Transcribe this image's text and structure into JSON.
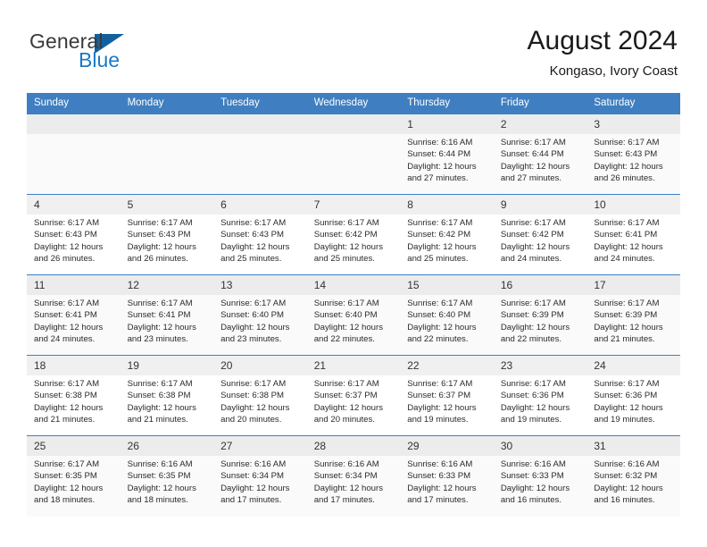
{
  "logo": {
    "word_one": "General",
    "word_two": "Blue",
    "triangle_icon": "blue-triangle-icon",
    "accent_color": "#1a79c8"
  },
  "header": {
    "title": "August 2024",
    "subtitle": "Kongaso, Ivory Coast"
  },
  "colors": {
    "header_blue": "#3f7fc1",
    "daynum_band": "#f0f0f0",
    "row_shaded": "#fafafa",
    "text": "#2b2b2b"
  },
  "weekday_headers": [
    "Sunday",
    "Monday",
    "Tuesday",
    "Wednesday",
    "Thursday",
    "Friday",
    "Saturday"
  ],
  "weeks": [
    [
      {
        "day": "",
        "sunrise": "",
        "sunset": "",
        "daylight_line1": "",
        "daylight_line2": ""
      },
      {
        "day": "",
        "sunrise": "",
        "sunset": "",
        "daylight_line1": "",
        "daylight_line2": ""
      },
      {
        "day": "",
        "sunrise": "",
        "sunset": "",
        "daylight_line1": "",
        "daylight_line2": ""
      },
      {
        "day": "",
        "sunrise": "",
        "sunset": "",
        "daylight_line1": "",
        "daylight_line2": ""
      },
      {
        "day": "1",
        "sunrise": "Sunrise: 6:16 AM",
        "sunset": "Sunset: 6:44 PM",
        "daylight_line1": "Daylight: 12 hours",
        "daylight_line2": "and 27 minutes."
      },
      {
        "day": "2",
        "sunrise": "Sunrise: 6:17 AM",
        "sunset": "Sunset: 6:44 PM",
        "daylight_line1": "Daylight: 12 hours",
        "daylight_line2": "and 27 minutes."
      },
      {
        "day": "3",
        "sunrise": "Sunrise: 6:17 AM",
        "sunset": "Sunset: 6:43 PM",
        "daylight_line1": "Daylight: 12 hours",
        "daylight_line2": "and 26 minutes."
      }
    ],
    [
      {
        "day": "4",
        "sunrise": "Sunrise: 6:17 AM",
        "sunset": "Sunset: 6:43 PM",
        "daylight_line1": "Daylight: 12 hours",
        "daylight_line2": "and 26 minutes."
      },
      {
        "day": "5",
        "sunrise": "Sunrise: 6:17 AM",
        "sunset": "Sunset: 6:43 PM",
        "daylight_line1": "Daylight: 12 hours",
        "daylight_line2": "and 26 minutes."
      },
      {
        "day": "6",
        "sunrise": "Sunrise: 6:17 AM",
        "sunset": "Sunset: 6:43 PM",
        "daylight_line1": "Daylight: 12 hours",
        "daylight_line2": "and 25 minutes."
      },
      {
        "day": "7",
        "sunrise": "Sunrise: 6:17 AM",
        "sunset": "Sunset: 6:42 PM",
        "daylight_line1": "Daylight: 12 hours",
        "daylight_line2": "and 25 minutes."
      },
      {
        "day": "8",
        "sunrise": "Sunrise: 6:17 AM",
        "sunset": "Sunset: 6:42 PM",
        "daylight_line1": "Daylight: 12 hours",
        "daylight_line2": "and 25 minutes."
      },
      {
        "day": "9",
        "sunrise": "Sunrise: 6:17 AM",
        "sunset": "Sunset: 6:42 PM",
        "daylight_line1": "Daylight: 12 hours",
        "daylight_line2": "and 24 minutes."
      },
      {
        "day": "10",
        "sunrise": "Sunrise: 6:17 AM",
        "sunset": "Sunset: 6:41 PM",
        "daylight_line1": "Daylight: 12 hours",
        "daylight_line2": "and 24 minutes."
      }
    ],
    [
      {
        "day": "11",
        "sunrise": "Sunrise: 6:17 AM",
        "sunset": "Sunset: 6:41 PM",
        "daylight_line1": "Daylight: 12 hours",
        "daylight_line2": "and 24 minutes."
      },
      {
        "day": "12",
        "sunrise": "Sunrise: 6:17 AM",
        "sunset": "Sunset: 6:41 PM",
        "daylight_line1": "Daylight: 12 hours",
        "daylight_line2": "and 23 minutes."
      },
      {
        "day": "13",
        "sunrise": "Sunrise: 6:17 AM",
        "sunset": "Sunset: 6:40 PM",
        "daylight_line1": "Daylight: 12 hours",
        "daylight_line2": "and 23 minutes."
      },
      {
        "day": "14",
        "sunrise": "Sunrise: 6:17 AM",
        "sunset": "Sunset: 6:40 PM",
        "daylight_line1": "Daylight: 12 hours",
        "daylight_line2": "and 22 minutes."
      },
      {
        "day": "15",
        "sunrise": "Sunrise: 6:17 AM",
        "sunset": "Sunset: 6:40 PM",
        "daylight_line1": "Daylight: 12 hours",
        "daylight_line2": "and 22 minutes."
      },
      {
        "day": "16",
        "sunrise": "Sunrise: 6:17 AM",
        "sunset": "Sunset: 6:39 PM",
        "daylight_line1": "Daylight: 12 hours",
        "daylight_line2": "and 22 minutes."
      },
      {
        "day": "17",
        "sunrise": "Sunrise: 6:17 AM",
        "sunset": "Sunset: 6:39 PM",
        "daylight_line1": "Daylight: 12 hours",
        "daylight_line2": "and 21 minutes."
      }
    ],
    [
      {
        "day": "18",
        "sunrise": "Sunrise: 6:17 AM",
        "sunset": "Sunset: 6:38 PM",
        "daylight_line1": "Daylight: 12 hours",
        "daylight_line2": "and 21 minutes."
      },
      {
        "day": "19",
        "sunrise": "Sunrise: 6:17 AM",
        "sunset": "Sunset: 6:38 PM",
        "daylight_line1": "Daylight: 12 hours",
        "daylight_line2": "and 21 minutes."
      },
      {
        "day": "20",
        "sunrise": "Sunrise: 6:17 AM",
        "sunset": "Sunset: 6:38 PM",
        "daylight_line1": "Daylight: 12 hours",
        "daylight_line2": "and 20 minutes."
      },
      {
        "day": "21",
        "sunrise": "Sunrise: 6:17 AM",
        "sunset": "Sunset: 6:37 PM",
        "daylight_line1": "Daylight: 12 hours",
        "daylight_line2": "and 20 minutes."
      },
      {
        "day": "22",
        "sunrise": "Sunrise: 6:17 AM",
        "sunset": "Sunset: 6:37 PM",
        "daylight_line1": "Daylight: 12 hours",
        "daylight_line2": "and 19 minutes."
      },
      {
        "day": "23",
        "sunrise": "Sunrise: 6:17 AM",
        "sunset": "Sunset: 6:36 PM",
        "daylight_line1": "Daylight: 12 hours",
        "daylight_line2": "and 19 minutes."
      },
      {
        "day": "24",
        "sunrise": "Sunrise: 6:17 AM",
        "sunset": "Sunset: 6:36 PM",
        "daylight_line1": "Daylight: 12 hours",
        "daylight_line2": "and 19 minutes."
      }
    ],
    [
      {
        "day": "25",
        "sunrise": "Sunrise: 6:17 AM",
        "sunset": "Sunset: 6:35 PM",
        "daylight_line1": "Daylight: 12 hours",
        "daylight_line2": "and 18 minutes."
      },
      {
        "day": "26",
        "sunrise": "Sunrise: 6:16 AM",
        "sunset": "Sunset: 6:35 PM",
        "daylight_line1": "Daylight: 12 hours",
        "daylight_line2": "and 18 minutes."
      },
      {
        "day": "27",
        "sunrise": "Sunrise: 6:16 AM",
        "sunset": "Sunset: 6:34 PM",
        "daylight_line1": "Daylight: 12 hours",
        "daylight_line2": "and 17 minutes."
      },
      {
        "day": "28",
        "sunrise": "Sunrise: 6:16 AM",
        "sunset": "Sunset: 6:34 PM",
        "daylight_line1": "Daylight: 12 hours",
        "daylight_line2": "and 17 minutes."
      },
      {
        "day": "29",
        "sunrise": "Sunrise: 6:16 AM",
        "sunset": "Sunset: 6:33 PM",
        "daylight_line1": "Daylight: 12 hours",
        "daylight_line2": "and 17 minutes."
      },
      {
        "day": "30",
        "sunrise": "Sunrise: 6:16 AM",
        "sunset": "Sunset: 6:33 PM",
        "daylight_line1": "Daylight: 12 hours",
        "daylight_line2": "and 16 minutes."
      },
      {
        "day": "31",
        "sunrise": "Sunrise: 6:16 AM",
        "sunset": "Sunset: 6:32 PM",
        "daylight_line1": "Daylight: 12 hours",
        "daylight_line2": "and 16 minutes."
      }
    ]
  ]
}
